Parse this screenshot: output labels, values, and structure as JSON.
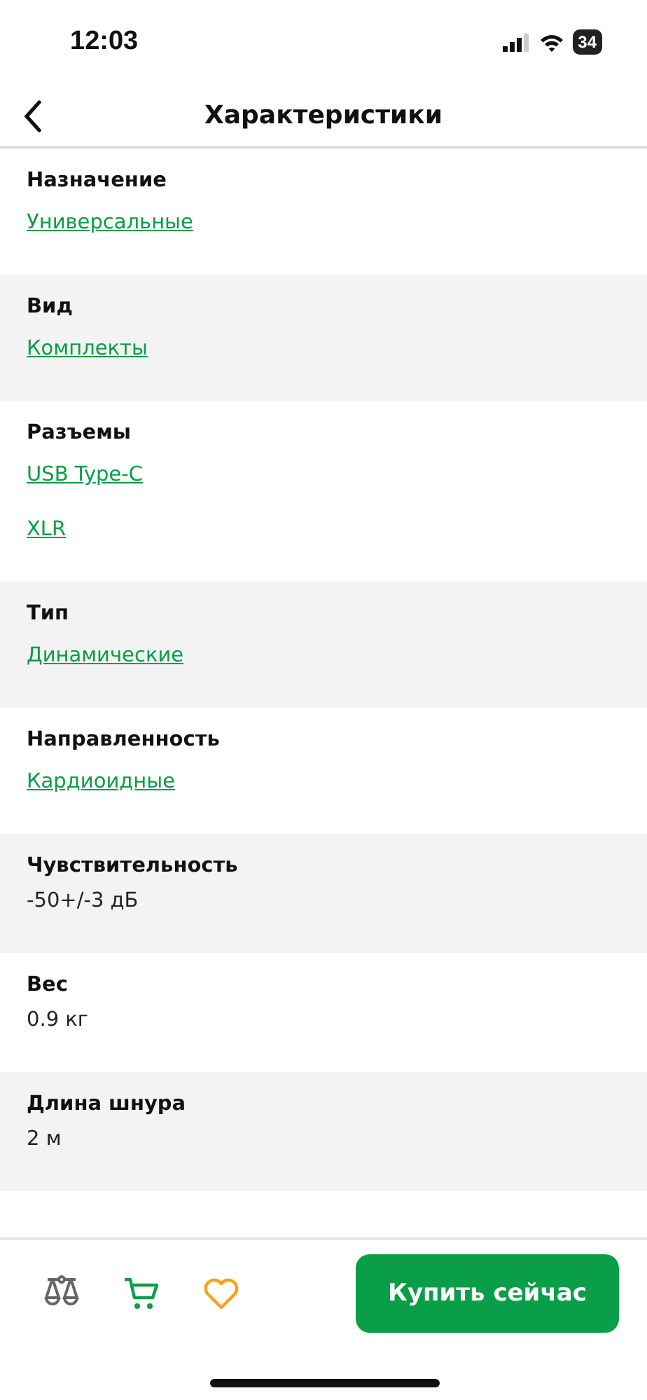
{
  "status_bar": {
    "time": "12:03",
    "battery": "34"
  },
  "nav": {
    "title": "Характеристики"
  },
  "sections": [
    {
      "title": "Назначение",
      "shaded": false,
      "values": [
        {
          "kind": "link",
          "text": "Универсальные"
        }
      ]
    },
    {
      "title": "Вид",
      "shaded": true,
      "values": [
        {
          "kind": "link",
          "text": "Комплекты"
        }
      ]
    },
    {
      "title": "Разъемы",
      "shaded": false,
      "values": [
        {
          "kind": "link",
          "text": "USB Type-C"
        },
        {
          "kind": "link",
          "text": "XLR"
        }
      ]
    },
    {
      "title": "Тип",
      "shaded": true,
      "values": [
        {
          "kind": "link",
          "text": "Динамические"
        }
      ]
    },
    {
      "title": "Направленность",
      "shaded": false,
      "values": [
        {
          "kind": "link",
          "text": "Кардиоидные"
        }
      ]
    },
    {
      "title": "Чувствительность",
      "shaded": true,
      "values": [
        {
          "kind": "text",
          "text": "-50+/-3 дБ"
        }
      ]
    },
    {
      "title": "Вес",
      "shaded": false,
      "values": [
        {
          "kind": "text",
          "text": "0.9 кг"
        }
      ]
    },
    {
      "title": "Длина шнура",
      "shaded": true,
      "values": [
        {
          "kind": "text",
          "text": "2 м"
        }
      ]
    }
  ],
  "bottom_bar": {
    "buy_button": "Купить сейчас"
  }
}
